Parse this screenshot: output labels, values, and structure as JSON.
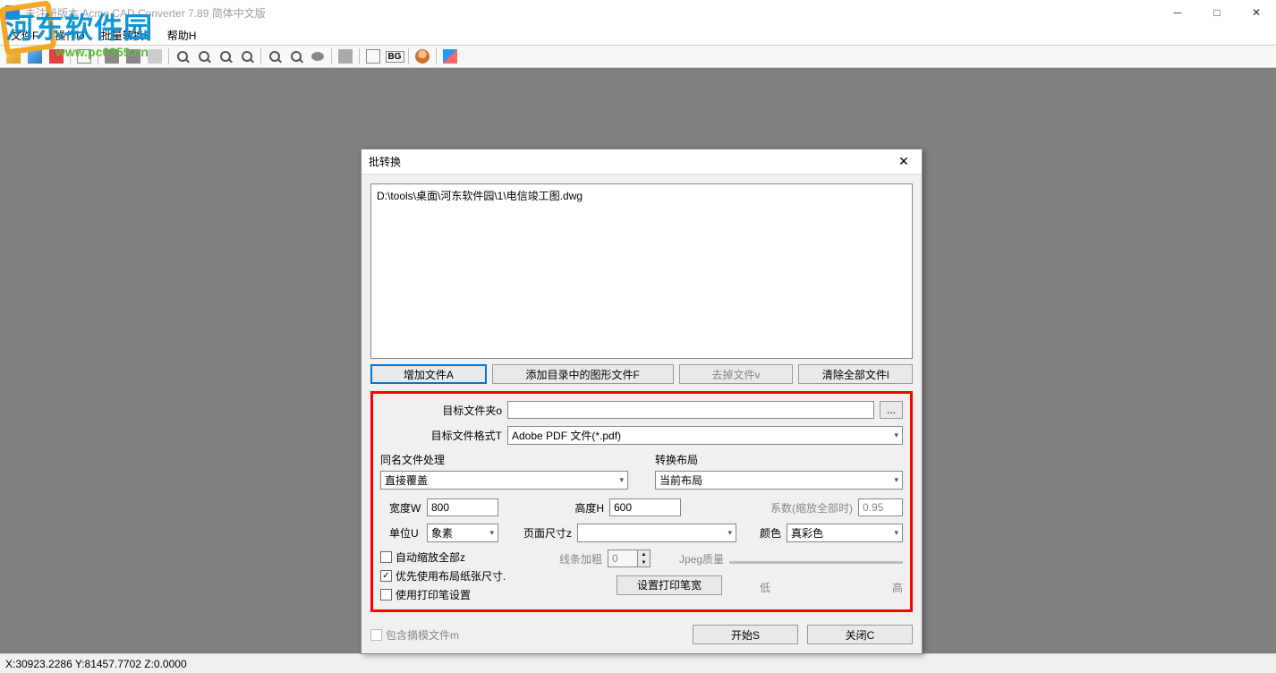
{
  "window": {
    "title": "未注册版本 Acme CAD Converter 7.89 简体中文版"
  },
  "menu": {
    "file": "文件F",
    "operate": "操作O",
    "batch": "批量转换B",
    "help": "帮助H"
  },
  "status": {
    "coords": "X:30923.2286 Y:81457.7702 Z:0.0000"
  },
  "dialog": {
    "title": "批转换",
    "file_list_item": "D:\\tools\\桌面\\河东软件园\\1\\电信竣工图.dwg",
    "buttons": {
      "add_files": "增加文件A",
      "add_dir_files": "添加目录中的图形文件F",
      "remove_file": "去掉文件v",
      "clear_all": "清除全部文件l"
    },
    "target_folder_label": "目标文件夹o",
    "target_folder_value": "",
    "target_format_label": "目标文件格式T",
    "target_format_value": "Adobe PDF 文件(*.pdf)",
    "same_name_label": "同名文件处理",
    "same_name_value": "直接覆盖",
    "layout_label": "转换布局",
    "layout_value": "当前布局",
    "width_label": "宽度W",
    "width_value": "800",
    "height_label": "高度H",
    "height_value": "600",
    "factor_label": "系数(缩放全部时)",
    "factor_value": "0.95",
    "unit_label": "单位U",
    "unit_value": "象素",
    "page_size_label": "页面尺寸z",
    "page_size_value": "",
    "color_label": "颜色",
    "color_value": "真彩色",
    "auto_scale_label": "自动缩放全部z",
    "prefer_layout_paper_label": "优先使用布局纸张尺寸.",
    "use_pen_label": "使用打印笔设置",
    "line_weight_label": "线条加粗",
    "line_weight_value": "0",
    "set_pen_btn": "设置打印笔宽",
    "jpeg_quality_label": "Jpeg质量",
    "low_label": "低",
    "high_label": "高",
    "include_template_label": "包含摘模文件m",
    "start_btn": "开始S",
    "close_btn": "关闭C"
  },
  "watermark": {
    "name": "河东软件园",
    "url": "www.pc0359.cn"
  }
}
